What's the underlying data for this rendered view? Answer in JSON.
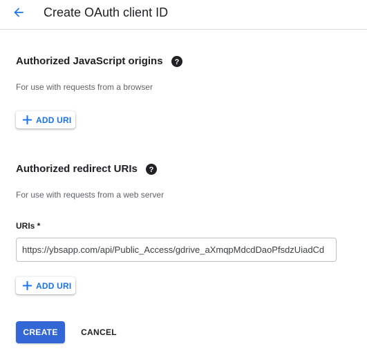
{
  "header": {
    "title": "Create OAuth client ID",
    "back_icon": "arrow-back-icon"
  },
  "js_origins": {
    "title": "Authorized JavaScript origins",
    "description": "For use with requests from a browser",
    "add_label": "ADD URI"
  },
  "redirect_uris": {
    "title": "Authorized redirect URIs",
    "description": "For use with requests from a web server",
    "field_label": "URIs *",
    "uri_value": "https://ybsapp.com/api/Public_Access/gdrive_aXmqpMdcdDaoPfsdzUiadCd",
    "add_label": "ADD URI"
  },
  "actions": {
    "create_label": "CREATE",
    "cancel_label": "CANCEL"
  },
  "colors": {
    "accent": "#1a73e8",
    "primary_button": "#3367d6",
    "text": "#202124",
    "secondary_text": "#5f6368"
  }
}
